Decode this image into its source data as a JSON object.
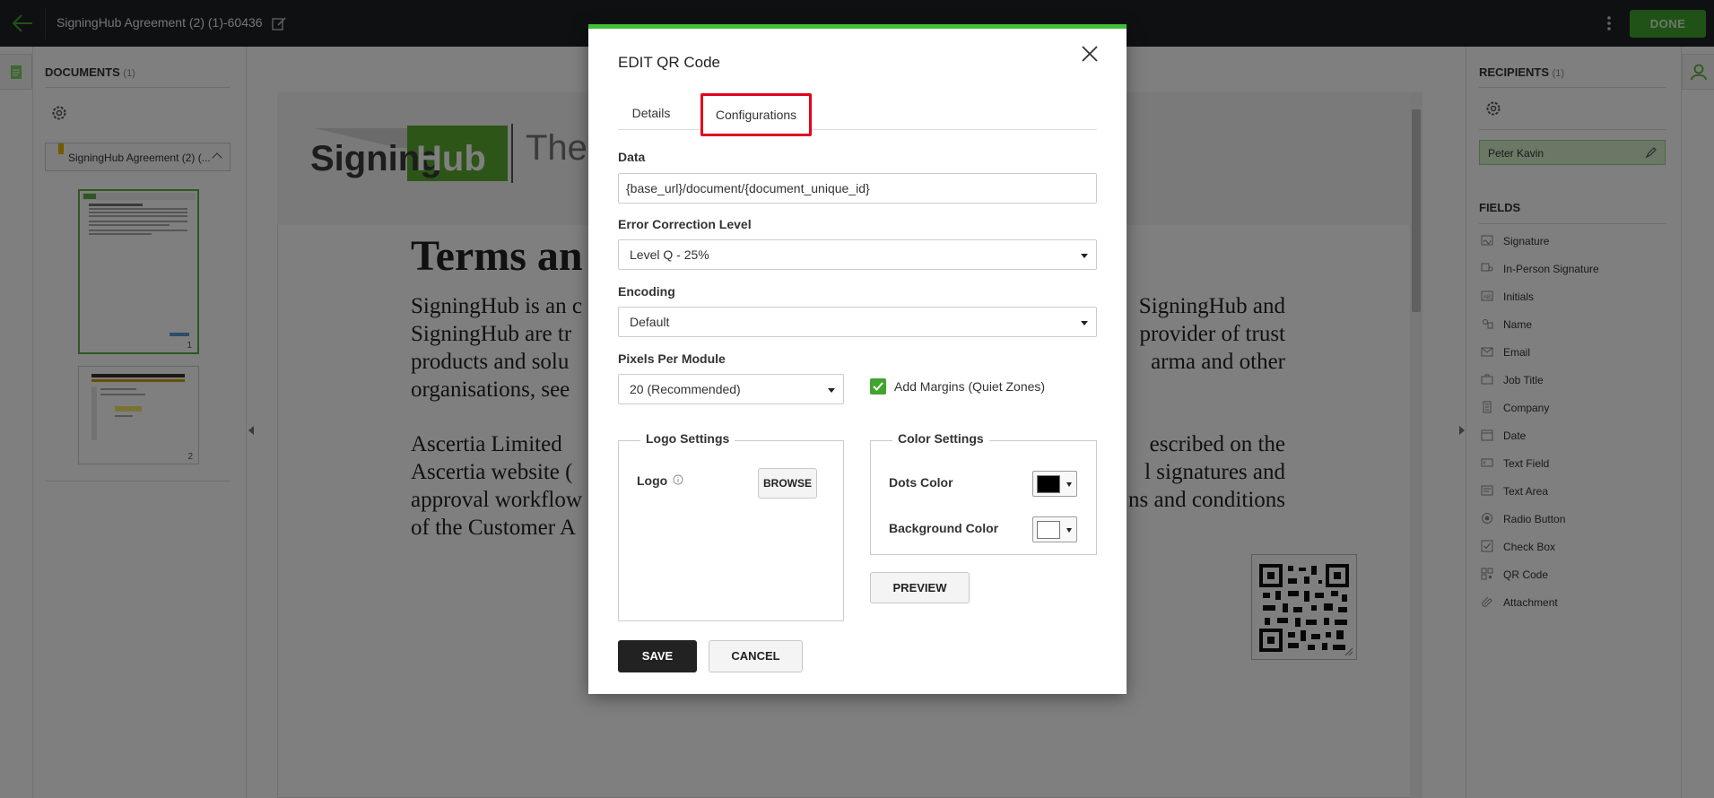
{
  "header": {
    "doc_title": "SigningHub Agreement (2) (1)-60436",
    "done_label": "DONE"
  },
  "left_panel": {
    "heading": "DOCUMENTS",
    "count": "(1)",
    "document_name": "SigningHub Agreement (2) (...",
    "pages": [
      "1",
      "2"
    ]
  },
  "document": {
    "logo_text": "SigningHub",
    "logo_suffix": "The",
    "heading": "Terms an",
    "para1_lines": [
      "SigningHub is an c",
      "SigningHub are tr",
      "products and solu",
      "organisations, see"
    ],
    "para1_right_lines": [
      "SigningHub and",
      "provider of trust",
      "arma and other"
    ],
    "para2_lines": [
      "Ascertia Limited",
      "Ascertia website (",
      "approval workflow",
      "of the Customer A"
    ],
    "para2_right_lines": [
      "escribed on the",
      "l signatures and",
      "ns and conditions"
    ]
  },
  "right_panel": {
    "recipients_heading": "RECIPIENTS",
    "recipients_count": "(1)",
    "recipient_name": "Peter Kavin",
    "fields_heading": "FIELDS",
    "fields": [
      {
        "label": "Signature",
        "icon": "signature-icon"
      },
      {
        "label": "In-Person Signature",
        "icon": "in-person-signature-icon"
      },
      {
        "label": "Initials",
        "icon": "initials-icon"
      },
      {
        "label": "Name",
        "icon": "name-icon"
      },
      {
        "label": "Email",
        "icon": "email-icon"
      },
      {
        "label": "Job Title",
        "icon": "job-title-icon"
      },
      {
        "label": "Company",
        "icon": "company-icon"
      },
      {
        "label": "Date",
        "icon": "date-icon"
      },
      {
        "label": "Text Field",
        "icon": "text-field-icon"
      },
      {
        "label": "Text Area",
        "icon": "text-area-icon"
      },
      {
        "label": "Radio Button",
        "icon": "radio-button-icon"
      },
      {
        "label": "Check Box",
        "icon": "check-box-icon"
      },
      {
        "label": "QR Code",
        "icon": "qr-code-icon"
      },
      {
        "label": "Attachment",
        "icon": "attachment-icon"
      }
    ]
  },
  "modal": {
    "title": "EDIT QR Code",
    "tabs": {
      "details": "Details",
      "configurations": "Configurations",
      "active": "configurations"
    },
    "data_label": "Data",
    "data_value": "{base_url}/document/{document_unique_id}",
    "ecl_label": "Error Correction Level",
    "ecl_value": "Level Q - 25%",
    "encoding_label": "Encoding",
    "encoding_value": "Default",
    "ppm_label": "Pixels Per Module",
    "ppm_value": "20 (Recommended)",
    "margins_label": "Add Margins (Quiet Zones)",
    "margins_checked": true,
    "logo_settings": {
      "legend": "Logo Settings",
      "logo_label": "Logo",
      "browse_label": "BROWSE"
    },
    "color_settings": {
      "legend": "Color Settings",
      "dots_label": "Dots Color",
      "dots_color": "#000000",
      "bg_label": "Background Color",
      "bg_color": "#ffffff"
    },
    "preview_label": "PREVIEW",
    "save_label": "SAVE",
    "cancel_label": "CANCEL"
  },
  "colors": {
    "accent_green": "#41a42e",
    "modal_top_border": "#41c035",
    "highlight_red": "#e3001b"
  }
}
